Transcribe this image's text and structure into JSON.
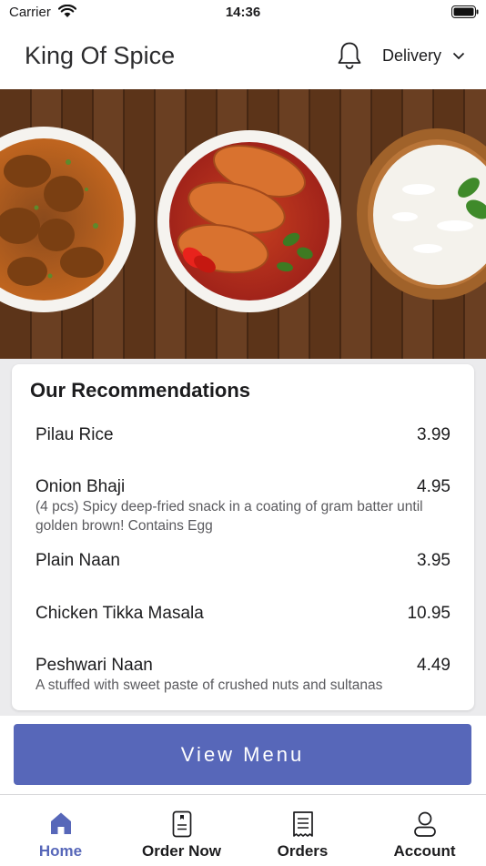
{
  "status_bar": {
    "carrier": "Carrier",
    "time": "14:36"
  },
  "header": {
    "title": "King Of Spice",
    "delivery_label": "Delivery"
  },
  "icons": {
    "bell": "bell-icon",
    "chevron": "chevron-down-icon",
    "home": "home-icon",
    "order": "order-icon",
    "orders": "receipt-icon",
    "account": "account-icon"
  },
  "recommendations": {
    "title": "Our Recommendations",
    "items": [
      {
        "name": "Pilau Rice",
        "price": "3.99",
        "description": ""
      },
      {
        "name": "Onion Bhaji",
        "price": "4.95",
        "description": "(4 pcs) Spicy deep-fried snack in a coating of gram batter until golden brown! Contains Egg"
      },
      {
        "name": "Plain Naan",
        "price": "3.95",
        "description": ""
      },
      {
        "name": "Chicken Tikka Masala",
        "price": "10.95",
        "description": ""
      },
      {
        "name": "Peshwari Naan",
        "price": "4.49",
        "description": "A stuffed with sweet paste of crushed nuts and sultanas"
      }
    ]
  },
  "view_menu_label": "View Menu",
  "tabs": [
    {
      "label": "Home",
      "active": true
    },
    {
      "label": "Order Now",
      "active": false
    },
    {
      "label": "Orders",
      "active": false
    },
    {
      "label": "Account",
      "active": false
    }
  ],
  "colors": {
    "accent": "#5767b9",
    "background": "#ebebed"
  }
}
